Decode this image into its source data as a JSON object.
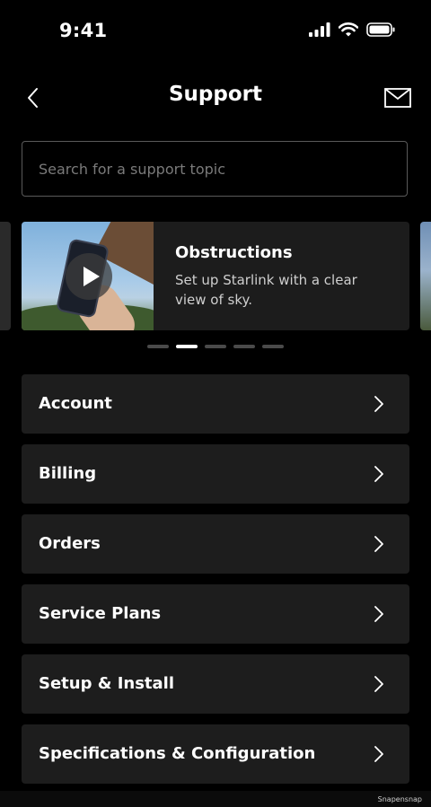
{
  "status_bar": {
    "time": "9:41"
  },
  "header": {
    "title": "Support"
  },
  "search": {
    "placeholder": "Search for a support topic"
  },
  "carousel": {
    "active_index": 1,
    "dot_count": 5,
    "card": {
      "title": "Obstructions",
      "description": "Set up Starlink with a clear view of sky."
    }
  },
  "topics": [
    {
      "label": "Account"
    },
    {
      "label": "Billing"
    },
    {
      "label": "Orders"
    },
    {
      "label": "Service Plans"
    },
    {
      "label": "Setup & Install"
    },
    {
      "label": "Specifications & Configuration"
    }
  ],
  "watermark": "Snapensnap",
  "colors": {
    "background": "#000000",
    "card": "#1d1d1d",
    "text": "#ffffff",
    "muted_text": "#cfcfcf",
    "placeholder": "#7a7a7a",
    "dot_inactive": "#4a4a4a",
    "dot_active": "#ffffff"
  }
}
